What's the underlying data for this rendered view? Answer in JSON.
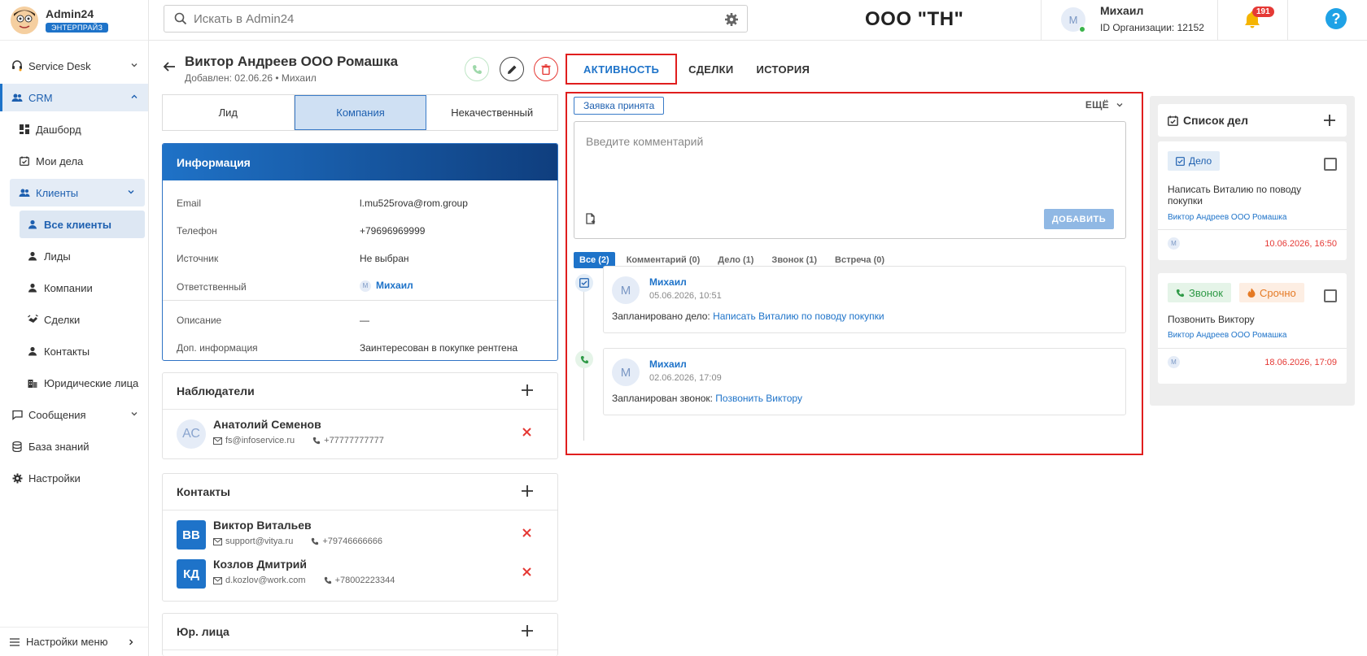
{
  "app": {
    "name": "Admin24",
    "edition": "ЭНТЕРПРАЙЗ"
  },
  "search": {
    "placeholder": "Искать в Admin24"
  },
  "org_title": "ООО \"ТН\"",
  "user": {
    "avatar": "М",
    "name": "Михаил",
    "org": "ID Организации: 12152"
  },
  "notifications": {
    "count": "191"
  },
  "help": "?",
  "sidebar": {
    "items": [
      {
        "label": "Service Desk"
      },
      {
        "label": "CRM"
      },
      {
        "label": "Дашборд"
      },
      {
        "label": "Мои дела"
      },
      {
        "label": "Клиенты"
      },
      {
        "label": "Все клиенты"
      },
      {
        "label": "Лиды"
      },
      {
        "label": "Компании"
      },
      {
        "label": "Сделки"
      },
      {
        "label": "Контакты"
      },
      {
        "label": "Юридические лица"
      },
      {
        "label": "Сообщения"
      },
      {
        "label": "База знаний"
      },
      {
        "label": "Настройки"
      }
    ],
    "footer": "Настройки меню"
  },
  "client": {
    "name": "Виктор Андреев ООО Ромашка",
    "subtitle": "Добавлен: 02.06.26 • Михаил"
  },
  "segments": [
    "Лид",
    "Компания",
    "Некачественный"
  ],
  "info": {
    "title": "Информация",
    "rows": [
      {
        "label": "Email",
        "value": "l.mu525rova@rom.group"
      },
      {
        "label": "Телефон",
        "value": "+79696969999"
      },
      {
        "label": "Источник",
        "value": "Не выбран"
      },
      {
        "label": "Ответственный",
        "value": "Михаил",
        "avatar": "М"
      },
      {
        "label": "Описание",
        "value": "—"
      },
      {
        "label": "Доп. информация",
        "value": "Заинтересован в покупке рентгена"
      }
    ]
  },
  "observers": {
    "title": "Наблюдатели",
    "people": [
      {
        "initials": "АС",
        "name": "Анатолий Семенов",
        "email": "fs@infoservice.ru",
        "phone": "+77777777777"
      }
    ]
  },
  "contacts": {
    "title": "Контакты",
    "people": [
      {
        "initials": "ВВ",
        "name": "Виктор Витальев",
        "email": "support@vitya.ru",
        "phone": "+79746666666"
      },
      {
        "initials": "КД",
        "name": "Козлов Дмитрий",
        "email": "d.kozlov@work.com",
        "phone": "+78002223344"
      }
    ]
  },
  "legal": {
    "title": "Юр. лица"
  },
  "tabs": [
    "АКТИВНОСТЬ",
    "СДЕЛКИ",
    "ИСТОРИЯ"
  ],
  "activity": {
    "status": "Заявка принята",
    "more": "ЕЩЁ",
    "comment_placeholder": "Введите комментарий",
    "add_button": "ДОБАВИТЬ",
    "filters": [
      "Все (2)",
      "Комментарий (0)",
      "Дело (1)",
      "Звонок (1)",
      "Встреча (0)"
    ],
    "events": [
      {
        "avatar": "М",
        "author": "Михаил",
        "date": "05.06.2026, 10:51",
        "prefix": "Запланировано дело: ",
        "link": "Написать Виталию по поводу покупки"
      },
      {
        "avatar": "М",
        "author": "Михаил",
        "date": "02.06.2026, 17:09",
        "prefix": "Запланирован звонок: ",
        "link": "Позвонить Виктору"
      }
    ]
  },
  "todo": {
    "title": "Список дел",
    "cards": [
      {
        "chip": "Дело",
        "title": "Написать Виталию по поводу покупки",
        "client": "Виктор Андреев ООО Ромашка",
        "avatar": "М",
        "date": "10.06.2026, 16:50"
      },
      {
        "chip": "Звонок",
        "chip2": "Срочно",
        "title": "Позвонить Виктору",
        "client": "Виктор Андреев ООО Ромашка",
        "avatar": "М",
        "date": "18.06.2026, 17:09"
      }
    ]
  },
  "colors": {
    "accent": "#1e73c9",
    "highlight": "#e01e1e",
    "danger": "#e53935",
    "success": "#3ab34a"
  }
}
